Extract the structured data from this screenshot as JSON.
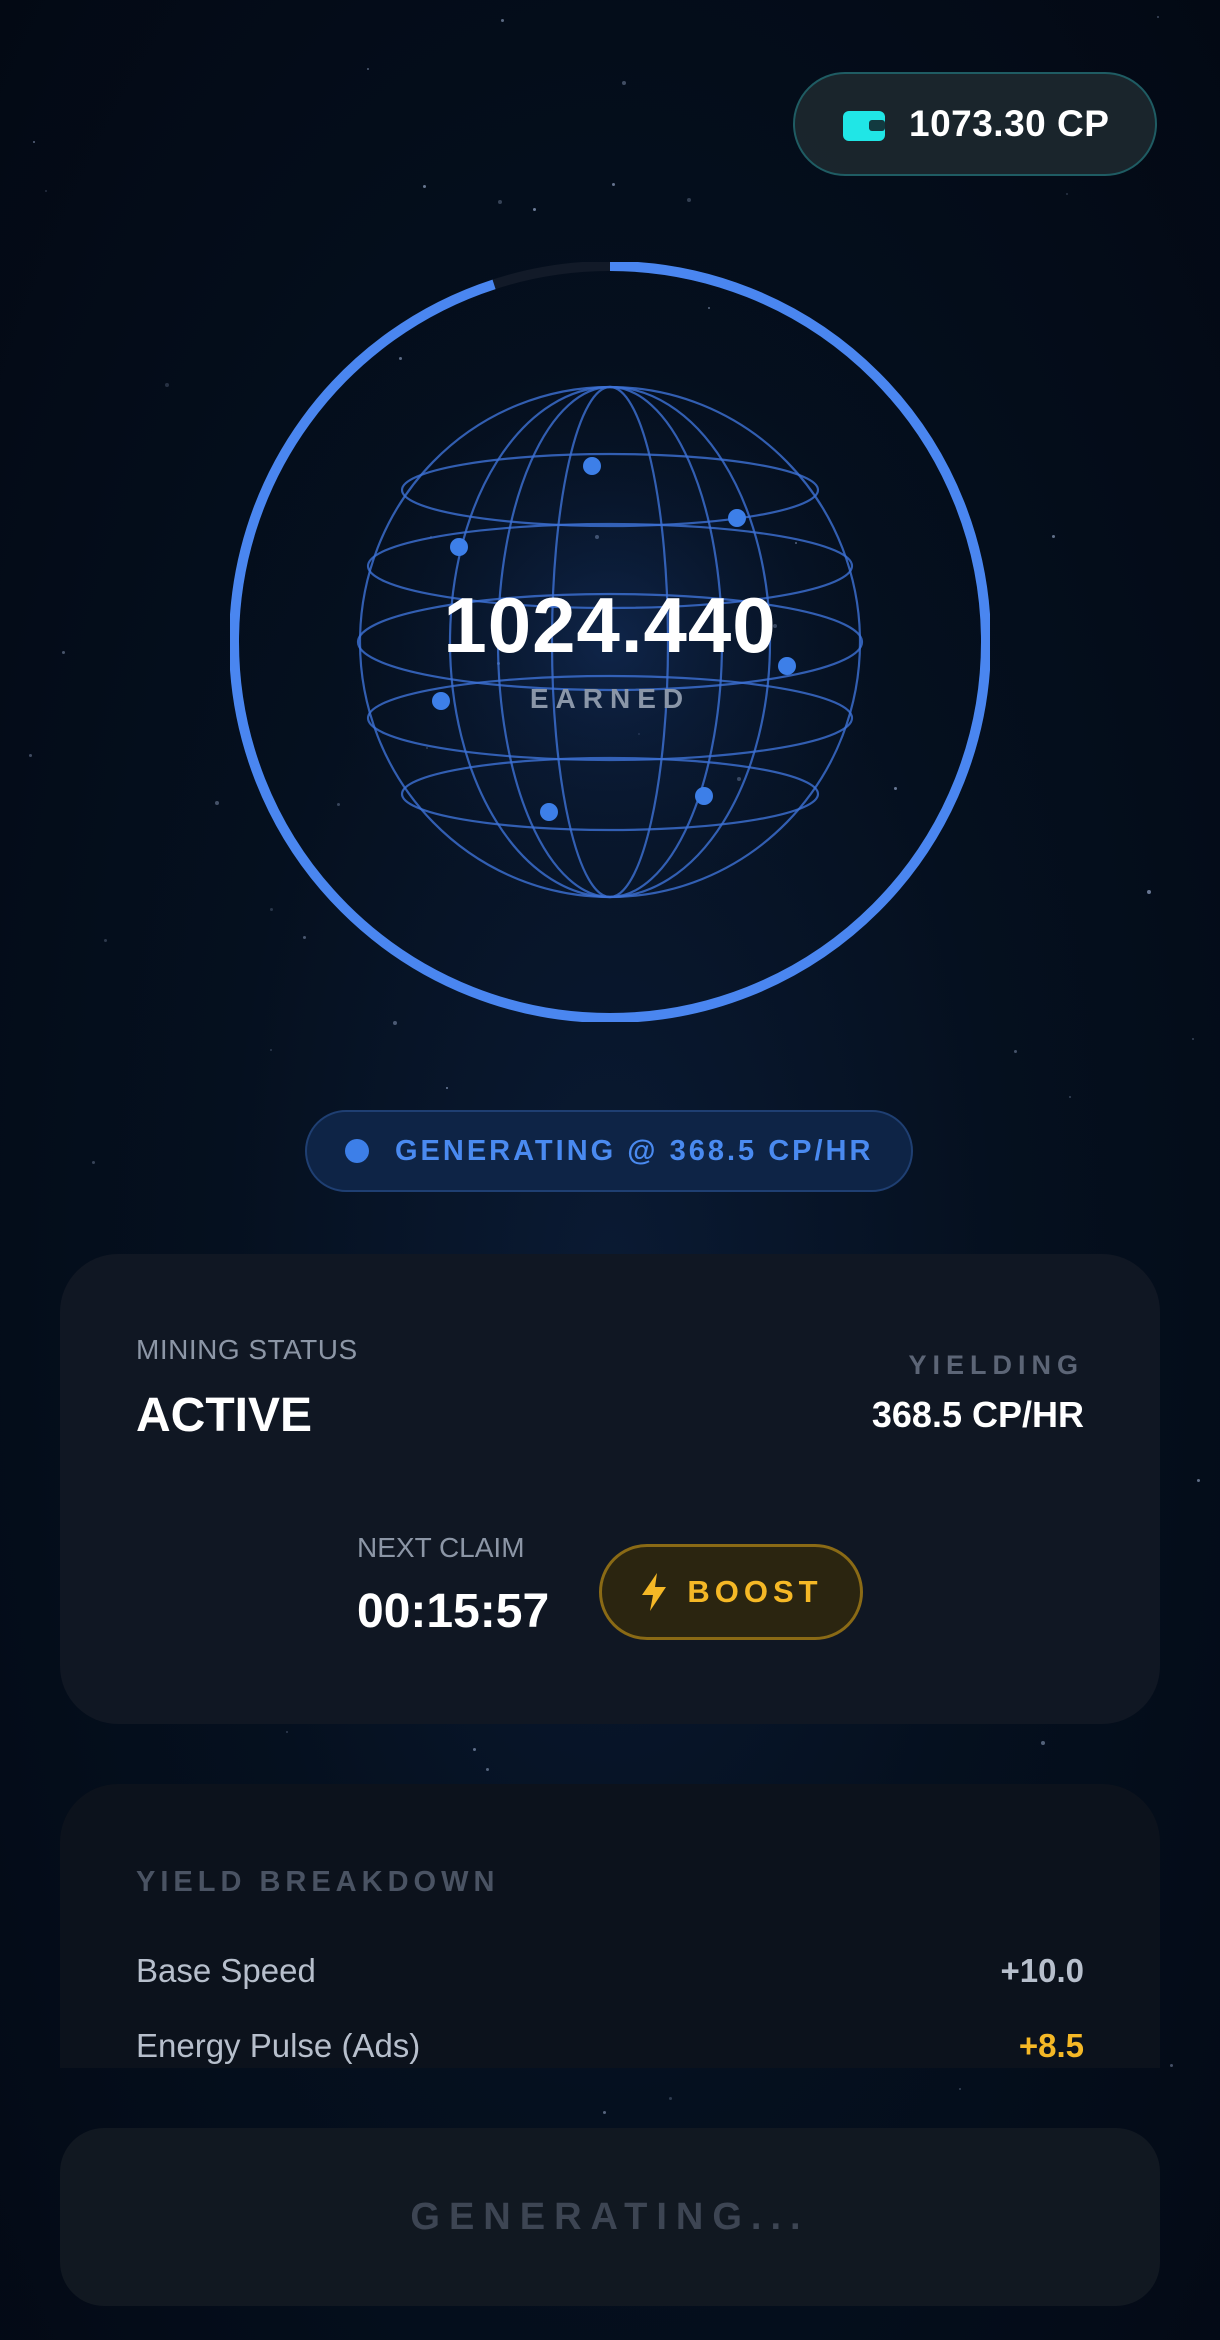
{
  "wallet": {
    "icon": "wallet-icon",
    "balance": "1073.30 CP",
    "icon_color": "#20E6E6"
  },
  "ring": {
    "progress": 0.95,
    "color": "#4A86F0",
    "track_color": "#121a28"
  },
  "earned": {
    "value": "1024.440",
    "label": "EARNED"
  },
  "status_pill": {
    "text": "GENERATING @ 368.5 CP/HR",
    "color": "#4A8AF0"
  },
  "mining_card": {
    "status_label": "MINING STATUS",
    "status_value": "ACTIVE",
    "yield_label": "YIELDING",
    "yield_value": "368.5 CP/HR",
    "claim_label": "NEXT CLAIM",
    "claim_value": "00:15:57",
    "boost_label": "BOOST",
    "boost_icon": "lightning-icon",
    "boost_color": "#F5B826"
  },
  "breakdown": {
    "title": "YIELD BREAKDOWN",
    "rows": [
      {
        "name": "Base Speed",
        "value": "+10.0",
        "color": "#B7BFCC"
      },
      {
        "name": "Energy Pulse (Ads)",
        "value": "+8.5",
        "color": "#F5B826"
      }
    ]
  },
  "bottom_button": {
    "label": "GENERATING..."
  }
}
